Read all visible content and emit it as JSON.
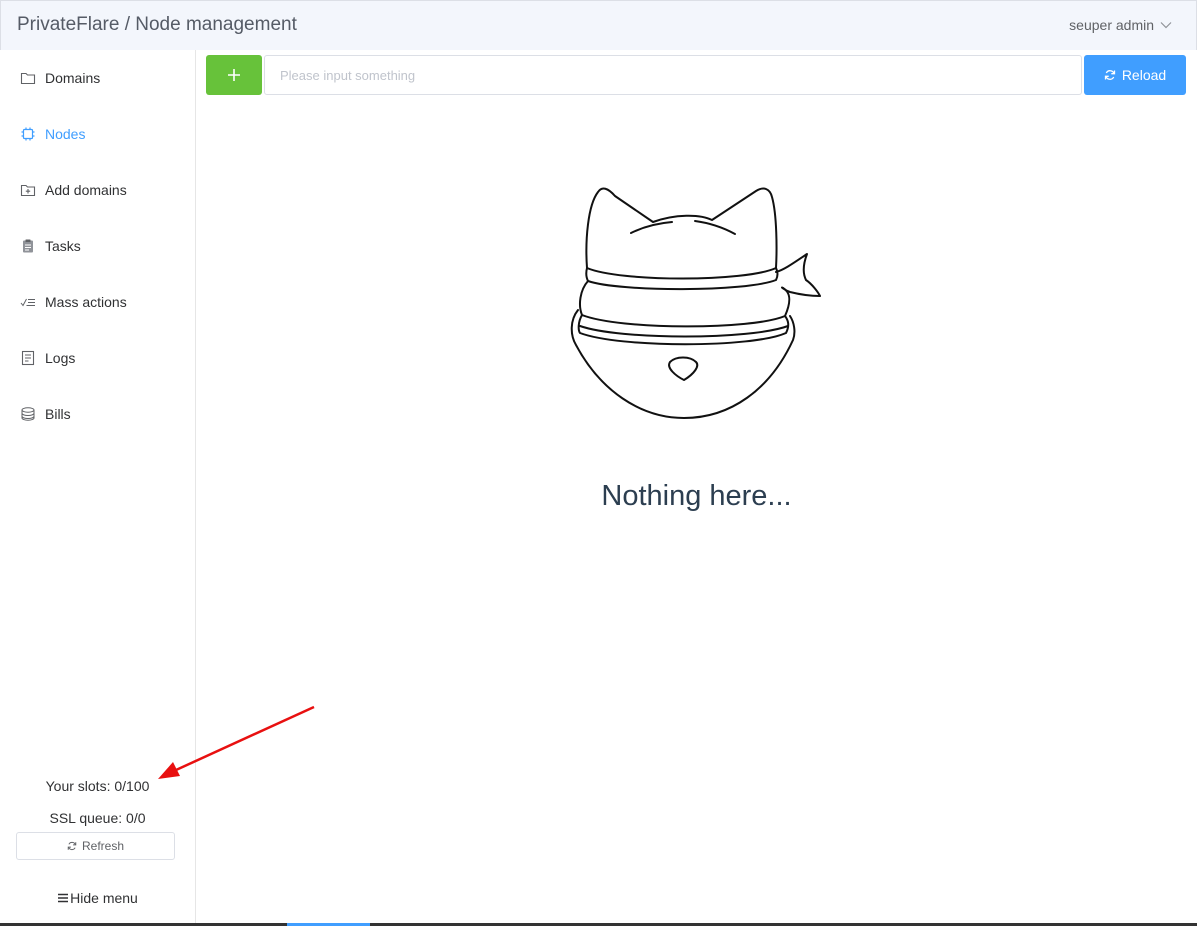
{
  "header": {
    "title": "PrivateFlare / Node management",
    "user": "seuper admin"
  },
  "sidebar": {
    "items": [
      {
        "label": "Domains",
        "icon": "folder-icon"
      },
      {
        "label": "Nodes",
        "icon": "cpu-icon",
        "active": true
      },
      {
        "label": "Add domains",
        "icon": "folder-add-icon"
      },
      {
        "label": "Tasks",
        "icon": "clipboard-icon"
      },
      {
        "label": "Mass actions",
        "icon": "checklist-icon"
      },
      {
        "label": "Logs",
        "icon": "document-icon"
      },
      {
        "label": "Bills",
        "icon": "coins-icon"
      }
    ],
    "slots": "Your slots: 0/100",
    "ssl_queue": "SSL queue: 0/0",
    "refresh_label": "Refresh",
    "hide_menu_label": "Hide menu"
  },
  "toolbar": {
    "add_icon": "plus-icon",
    "search_placeholder": "Please input something",
    "search_value": "",
    "reload_label": "Reload"
  },
  "main": {
    "empty_text": "Nothing here..."
  },
  "colors": {
    "accent": "#409eff",
    "success": "#67c23a",
    "header_bg": "#f3f6fc",
    "annotation": "#e81010"
  }
}
